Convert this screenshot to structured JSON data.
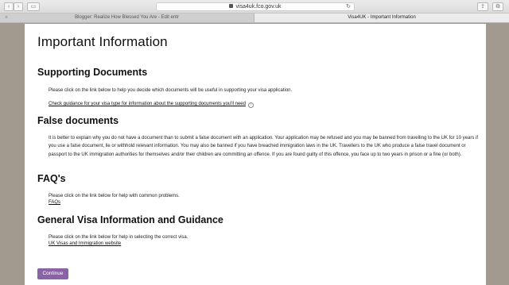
{
  "browser": {
    "url": "visa4uk.fco.gov.uk",
    "tabs": [
      {
        "label": "Blogger: Realize How Blessed You Are - Edit entr"
      },
      {
        "label": "Visa4UK - Important Information"
      }
    ]
  },
  "page": {
    "title": "Important Information",
    "sections": {
      "supporting": {
        "heading": "Supporting Documents",
        "text": "Please click on the link below to help you decide which documents will be useful in supporting your visa application.",
        "link": "Check guidance for your visa type for information about the supporting documents you'll need"
      },
      "false_docs": {
        "heading": "False documents",
        "text": "It is better to explain why you do not have a document than to submit a false document with an application. Your application may be refused and you may be banned from travelling to the UK for 10 years if you use a false document, lie or withhold relevant information. You may also be banned if you have breached immigration laws in the UK. Travellers to the UK who produce a false travel document or passport to the UK immigration authorities for themselves and/or their children are committing an offence. If you are found guilty of this offence, you face up to two years in prison or a fine (or both)."
      },
      "faqs": {
        "heading": "FAQ's",
        "text": "Please click on the link below for help with common problems.",
        "link": "FAQs"
      },
      "general": {
        "heading": "General Visa Information and Guidance",
        "text": "Please click on the link below for help in selecting the correct visa.",
        "link": "UK Visas and Immigration website"
      }
    },
    "continue_label": "Continue"
  }
}
